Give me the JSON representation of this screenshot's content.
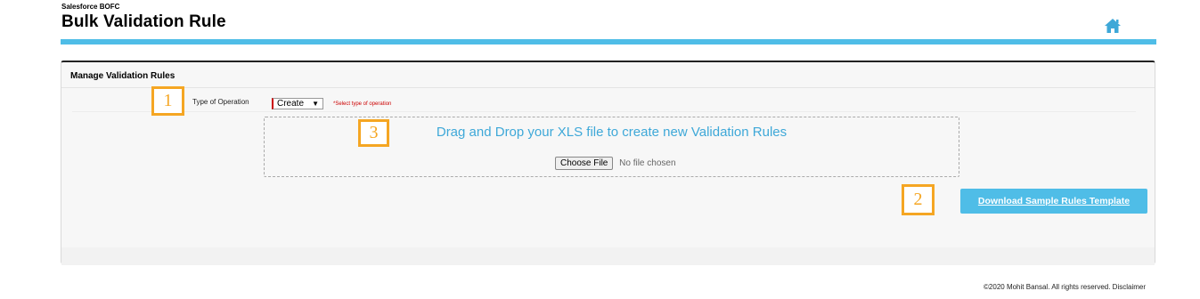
{
  "header": {
    "app_name": "Salesforce BOFC",
    "page_title": "Bulk Validation Rule",
    "home_icon": "home-icon",
    "accent_color": "#4fbde7"
  },
  "panel": {
    "title": "Manage Validation Rules",
    "operation": {
      "label": "Type of Operation",
      "selected": "Create",
      "hint": "*Select type of operation"
    },
    "dropzone": {
      "text": "Drag and Drop your XLS file to create new Validation Rules",
      "choose_file_label": "Choose File",
      "file_status": "No file chosen"
    },
    "download_label": "Download Sample Rules Template"
  },
  "annotations": {
    "m1": "1",
    "m2": "2",
    "m3": "3",
    "color": "#f5a623"
  },
  "footer": {
    "text": "©2020 Mohit Bansal. All rights reserved. Disclaimer"
  }
}
